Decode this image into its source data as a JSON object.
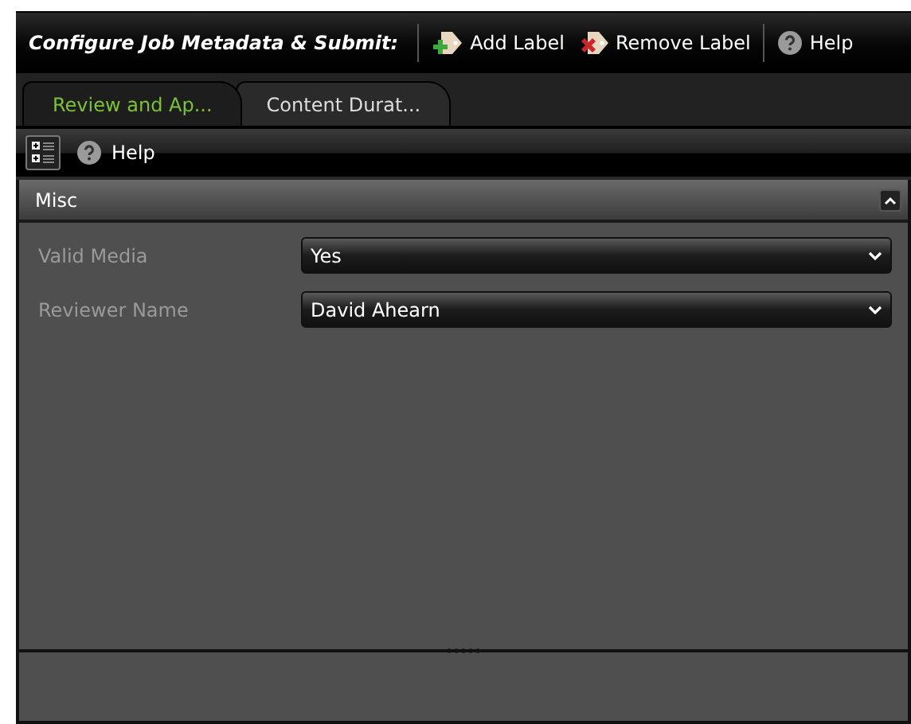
{
  "toolbar": {
    "title": "Configure Job Metadata & Submit:",
    "buttons": [
      {
        "kind": "add",
        "label": "Add Label"
      },
      {
        "kind": "remove",
        "label": "Remove Label"
      },
      {
        "kind": "help",
        "label": "Help"
      }
    ]
  },
  "tabs": [
    {
      "label": "Review and Ap...",
      "selected": true
    },
    {
      "label": "Content Durat...",
      "selected": false
    }
  ],
  "property_toolbar": {
    "categorized": true,
    "help_label": "Help"
  },
  "category": {
    "name": "Misc",
    "expanded": true
  },
  "properties": [
    {
      "name": "Valid Media",
      "value": "Yes"
    },
    {
      "name": "Reviewer Name",
      "value": "David Ahearn"
    }
  ]
}
